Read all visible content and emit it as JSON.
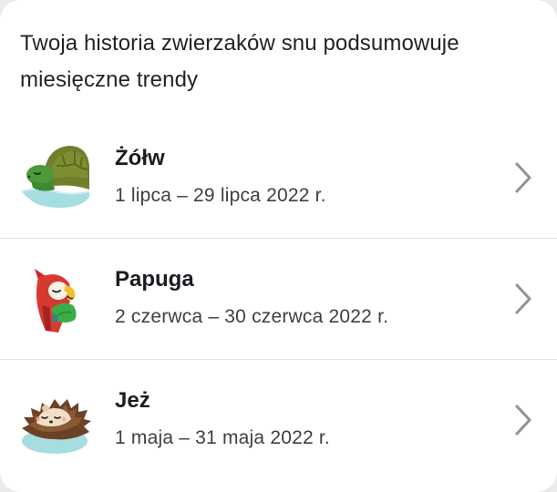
{
  "intro_text": "Twoja historia zwierzaków snu podsumowuje miesięczne trendy",
  "items": [
    {
      "name": "Żółw",
      "dates": "1 lipca – 29 lipca 2022 r.",
      "icon": "turtle-icon"
    },
    {
      "name": "Papuga",
      "dates": "2 czerwca – 30 czerwca 2022 r.",
      "icon": "parrot-icon"
    },
    {
      "name": "Jeż",
      "dates": "1 maja – 31 maja 2022 r.",
      "icon": "hedgehog-icon"
    }
  ],
  "colors": {
    "chevron": "#8e9399",
    "divider": "#e2e2e2",
    "text_primary": "#1a1d21",
    "text_secondary": "#3c4045"
  }
}
